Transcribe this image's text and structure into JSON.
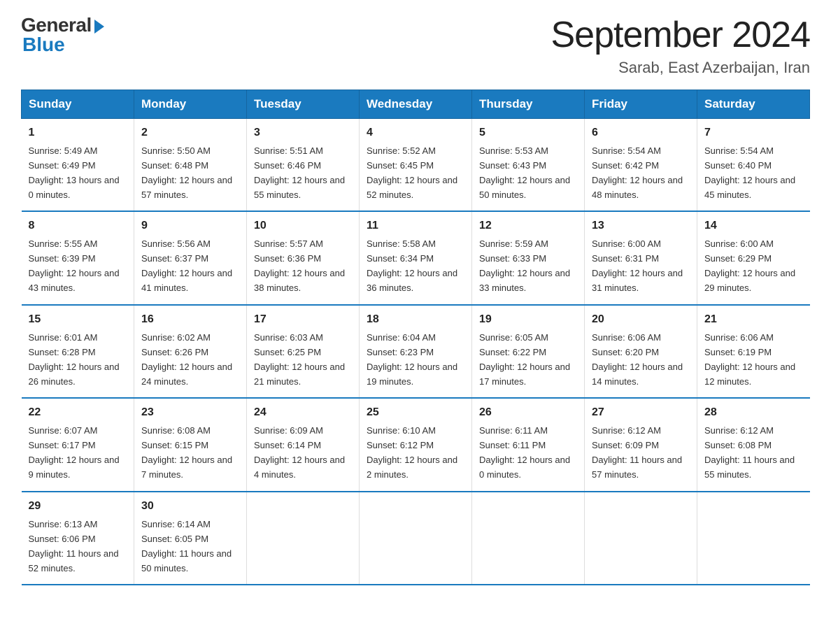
{
  "header": {
    "logo_general": "General",
    "logo_blue": "Blue",
    "title": "September 2024",
    "subtitle": "Sarab, East Azerbaijan, Iran"
  },
  "weekdays": [
    "Sunday",
    "Monday",
    "Tuesday",
    "Wednesday",
    "Thursday",
    "Friday",
    "Saturday"
  ],
  "weeks": [
    [
      {
        "day": "1",
        "sunrise": "5:49 AM",
        "sunset": "6:49 PM",
        "daylight": "13 hours and 0 minutes."
      },
      {
        "day": "2",
        "sunrise": "5:50 AM",
        "sunset": "6:48 PM",
        "daylight": "12 hours and 57 minutes."
      },
      {
        "day": "3",
        "sunrise": "5:51 AM",
        "sunset": "6:46 PM",
        "daylight": "12 hours and 55 minutes."
      },
      {
        "day": "4",
        "sunrise": "5:52 AM",
        "sunset": "6:45 PM",
        "daylight": "12 hours and 52 minutes."
      },
      {
        "day": "5",
        "sunrise": "5:53 AM",
        "sunset": "6:43 PM",
        "daylight": "12 hours and 50 minutes."
      },
      {
        "day": "6",
        "sunrise": "5:54 AM",
        "sunset": "6:42 PM",
        "daylight": "12 hours and 48 minutes."
      },
      {
        "day": "7",
        "sunrise": "5:54 AM",
        "sunset": "6:40 PM",
        "daylight": "12 hours and 45 minutes."
      }
    ],
    [
      {
        "day": "8",
        "sunrise": "5:55 AM",
        "sunset": "6:39 PM",
        "daylight": "12 hours and 43 minutes."
      },
      {
        "day": "9",
        "sunrise": "5:56 AM",
        "sunset": "6:37 PM",
        "daylight": "12 hours and 41 minutes."
      },
      {
        "day": "10",
        "sunrise": "5:57 AM",
        "sunset": "6:36 PM",
        "daylight": "12 hours and 38 minutes."
      },
      {
        "day": "11",
        "sunrise": "5:58 AM",
        "sunset": "6:34 PM",
        "daylight": "12 hours and 36 minutes."
      },
      {
        "day": "12",
        "sunrise": "5:59 AM",
        "sunset": "6:33 PM",
        "daylight": "12 hours and 33 minutes."
      },
      {
        "day": "13",
        "sunrise": "6:00 AM",
        "sunset": "6:31 PM",
        "daylight": "12 hours and 31 minutes."
      },
      {
        "day": "14",
        "sunrise": "6:00 AM",
        "sunset": "6:29 PM",
        "daylight": "12 hours and 29 minutes."
      }
    ],
    [
      {
        "day": "15",
        "sunrise": "6:01 AM",
        "sunset": "6:28 PM",
        "daylight": "12 hours and 26 minutes."
      },
      {
        "day": "16",
        "sunrise": "6:02 AM",
        "sunset": "6:26 PM",
        "daylight": "12 hours and 24 minutes."
      },
      {
        "day": "17",
        "sunrise": "6:03 AM",
        "sunset": "6:25 PM",
        "daylight": "12 hours and 21 minutes."
      },
      {
        "day": "18",
        "sunrise": "6:04 AM",
        "sunset": "6:23 PM",
        "daylight": "12 hours and 19 minutes."
      },
      {
        "day": "19",
        "sunrise": "6:05 AM",
        "sunset": "6:22 PM",
        "daylight": "12 hours and 17 minutes."
      },
      {
        "day": "20",
        "sunrise": "6:06 AM",
        "sunset": "6:20 PM",
        "daylight": "12 hours and 14 minutes."
      },
      {
        "day": "21",
        "sunrise": "6:06 AM",
        "sunset": "6:19 PM",
        "daylight": "12 hours and 12 minutes."
      }
    ],
    [
      {
        "day": "22",
        "sunrise": "6:07 AM",
        "sunset": "6:17 PM",
        "daylight": "12 hours and 9 minutes."
      },
      {
        "day": "23",
        "sunrise": "6:08 AM",
        "sunset": "6:15 PM",
        "daylight": "12 hours and 7 minutes."
      },
      {
        "day": "24",
        "sunrise": "6:09 AM",
        "sunset": "6:14 PM",
        "daylight": "12 hours and 4 minutes."
      },
      {
        "day": "25",
        "sunrise": "6:10 AM",
        "sunset": "6:12 PM",
        "daylight": "12 hours and 2 minutes."
      },
      {
        "day": "26",
        "sunrise": "6:11 AM",
        "sunset": "6:11 PM",
        "daylight": "12 hours and 0 minutes."
      },
      {
        "day": "27",
        "sunrise": "6:12 AM",
        "sunset": "6:09 PM",
        "daylight": "11 hours and 57 minutes."
      },
      {
        "day": "28",
        "sunrise": "6:12 AM",
        "sunset": "6:08 PM",
        "daylight": "11 hours and 55 minutes."
      }
    ],
    [
      {
        "day": "29",
        "sunrise": "6:13 AM",
        "sunset": "6:06 PM",
        "daylight": "11 hours and 52 minutes."
      },
      {
        "day": "30",
        "sunrise": "6:14 AM",
        "sunset": "6:05 PM",
        "daylight": "11 hours and 50 minutes."
      },
      null,
      null,
      null,
      null,
      null
    ]
  ]
}
